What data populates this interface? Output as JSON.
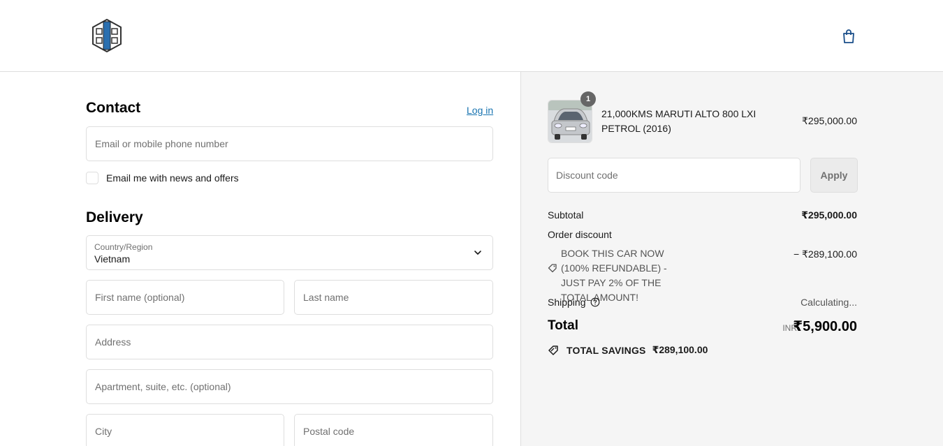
{
  "header": {
    "logo_icon": "store-logo",
    "cart_icon": "shopping-bag-icon"
  },
  "contact": {
    "title": "Contact",
    "login_label": "Log in",
    "email_placeholder": "Email or mobile phone number",
    "newsletter_label": "Email me with news and offers"
  },
  "delivery": {
    "title": "Delivery",
    "country_label": "Country/Region",
    "country_value": "Vietnam",
    "first_name_placeholder": "First name (optional)",
    "last_name_placeholder": "Last name",
    "address_placeholder": "Address",
    "apartment_placeholder": "Apartment, suite, etc. (optional)",
    "city_placeholder": "City",
    "postal_placeholder": "Postal code"
  },
  "summary": {
    "product": {
      "quantity": "1",
      "name": "21,000KMS MARUTI ALTO 800 LXI PETROL (2016)",
      "price": "₹295,000.00"
    },
    "discount_placeholder": "Discount code",
    "apply_label": "Apply",
    "subtotal_label": "Subtotal",
    "subtotal_value": "₹295,000.00",
    "order_discount_label": "Order discount",
    "discount_name": "BOOK THIS CAR NOW (100% REFUNDABLE) - JUST PAY 2% OF THE TOTAL AMOUNT!",
    "discount_value": "− ₹289,100.00",
    "shipping_label": "Shipping",
    "shipping_value": "Calculating...",
    "total_label": "Total",
    "total_currency": "INR",
    "total_value": "₹5,900.00",
    "savings_label": "TOTAL SAVINGS",
    "savings_value": "₹289,100.00"
  },
  "colors": {
    "link": "#1773b0",
    "summary_bg": "#f5f5f5",
    "border": "#dedede"
  }
}
